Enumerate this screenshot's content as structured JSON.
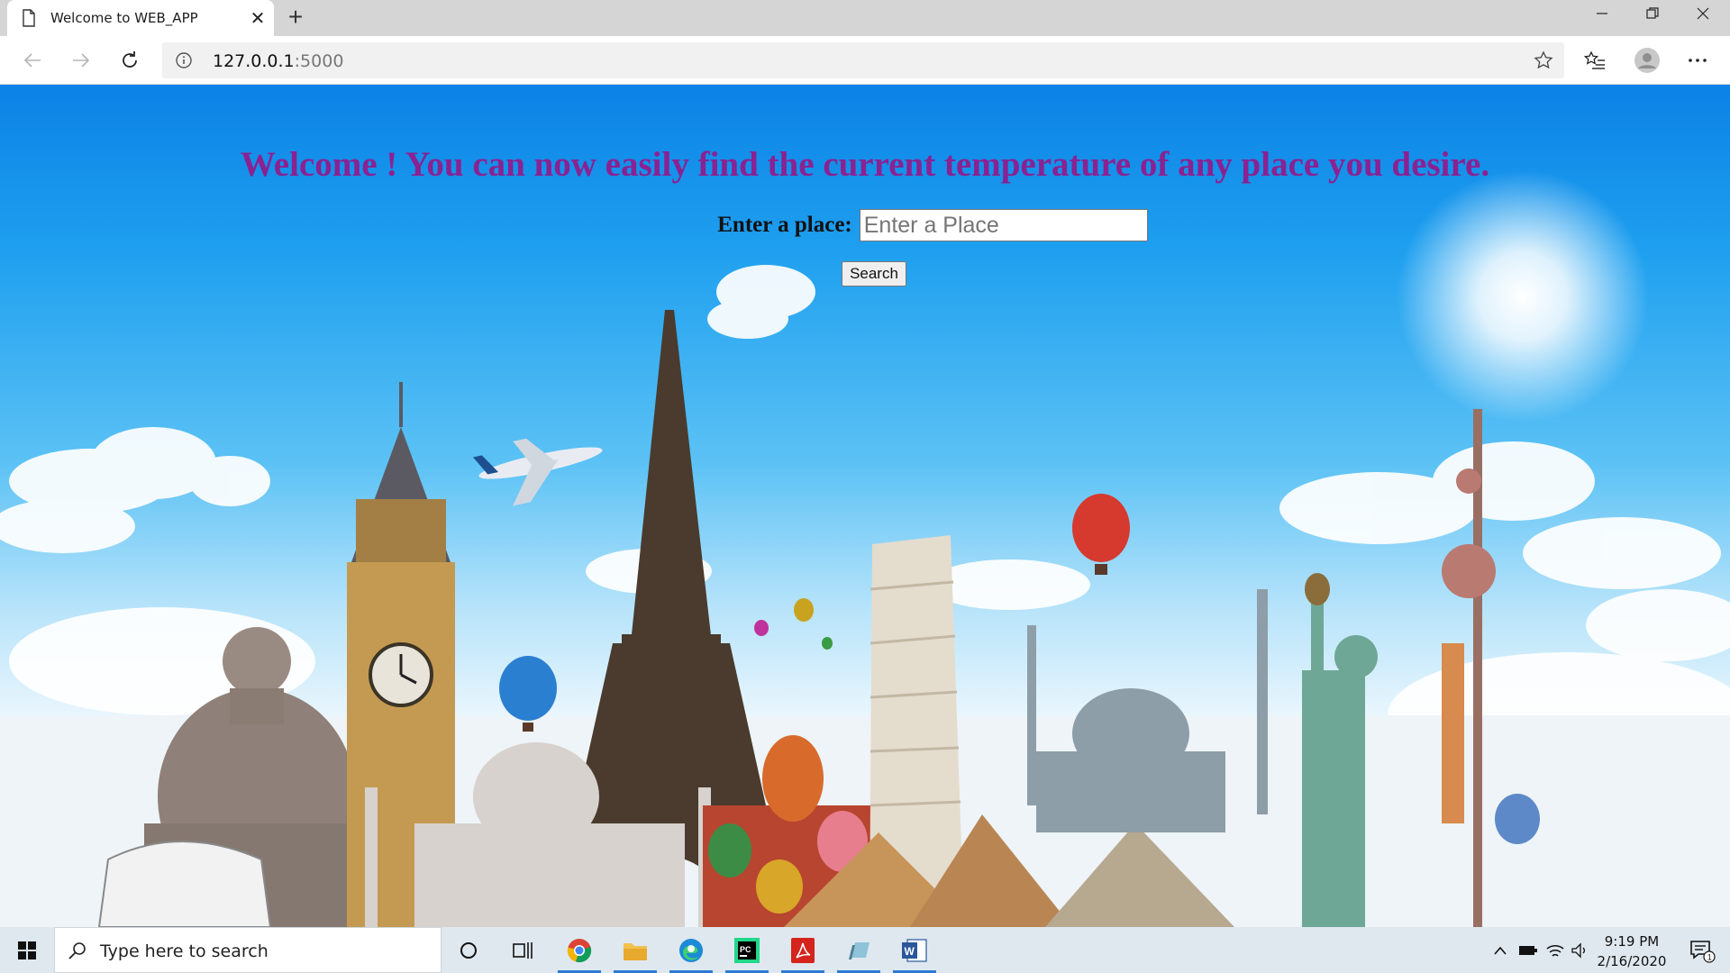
{
  "browser": {
    "tab_title": "Welcome to WEB_APP",
    "new_tab": "+",
    "url_host": "127.0.0.1",
    "url_port": ":5000"
  },
  "page": {
    "heading": "Welcome ! You can now easily find the current temperature of any place you desire.",
    "place_label": "Enter a place:",
    "place_placeholder": "Enter a Place",
    "search_button": "Search",
    "heading_color": "#8a2292"
  },
  "taskbar": {
    "search_placeholder": "Type here to search",
    "time": "9:19 PM",
    "date": "2/16/2020",
    "notification_count": "1",
    "apps": [
      "task-view",
      "chrome",
      "file-explorer",
      "edge",
      "pycharm",
      "acrobat-reader",
      "app",
      "word"
    ]
  },
  "colors": {
    "accent": "#2b7cd3",
    "sky_top": "#0b82e6"
  }
}
